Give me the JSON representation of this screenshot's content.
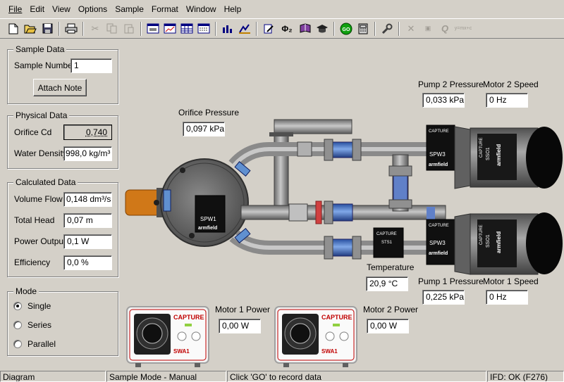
{
  "menu": [
    {
      "u": "F",
      "rest": "ile"
    },
    {
      "u": "E",
      "rest": "dit"
    },
    {
      "u": "V",
      "rest": "iew"
    },
    {
      "u": "O",
      "rest": "ptions"
    },
    {
      "u": "S",
      "rest": "ample"
    },
    {
      "u": "",
      "rest": "Format",
      "u_mid": "o"
    },
    {
      "u": "W",
      "rest": "indow"
    },
    {
      "u": "H",
      "rest": "elp"
    }
  ],
  "menu_labels": [
    "File",
    "Edit",
    "View",
    "Options",
    "Sample",
    "Format",
    "Window",
    "Help"
  ],
  "toolbar": {
    "go_label": "GO",
    "phi_label": "Φ₂",
    "q_label": "Q",
    "formula_label": "y=mx+c"
  },
  "sample_data": {
    "title": "Sample Data",
    "sample_number_label": "Sample Number",
    "sample_number_value": "1",
    "attach_note_label": "Attach Note"
  },
  "physical_data": {
    "title": "Physical Data",
    "orifice_cd_label": "Orifice Cd",
    "orifice_cd_value": "0,740",
    "water_density_label": "Water Density",
    "water_density_value": "998,0 kg/m³"
  },
  "calculated_data": {
    "title": "Calculated Data",
    "volume_flow_label": "Volume Flow",
    "volume_flow_value": "0,148 dm³/s",
    "total_head_label": "Total Head",
    "total_head_value": "0,07 m",
    "power_output_label": "Power Output",
    "power_output_value": "0,1 W",
    "efficiency_label": "Efficiency",
    "efficiency_value": "0,0 %"
  },
  "mode": {
    "title": "Mode",
    "options": [
      "Single",
      "Series",
      "Parallel"
    ],
    "selected": "Single"
  },
  "readings": {
    "orifice_pressure_label": "Orifice Pressure",
    "orifice_pressure_value": "0,097 kPa",
    "pump2_pressure_label": "Pump 2 Pressure",
    "pump2_pressure_value": "0,033 kPa",
    "motor2_speed_label": "Motor 2 Speed",
    "motor2_speed_value": "0 Hz",
    "temperature_label": "Temperature",
    "temperature_value": "20,9 °C",
    "pump1_pressure_label": "Pump 1 Pressure",
    "pump1_pressure_value": "0,225 kPa",
    "motor1_speed_label": "Motor 1 Speed",
    "motor1_speed_value": "0 Hz",
    "motor1_power_label": "Motor 1 Power",
    "motor1_power_value": "0,00 W",
    "motor2_power_label": "Motor 2 Power",
    "motor2_power_value": "0,00 W"
  },
  "equipment": {
    "capture": "CAPTURE",
    "armfield": "armfield",
    "spw1": "SPW1",
    "spw3": "SPW3",
    "sso1": "SSO1",
    "sts1": "STS1",
    "swa1": "SWA1"
  },
  "status": {
    "view": "Diagram",
    "mode": "Sample Mode - Manual",
    "hint": "Click 'GO' to record data",
    "ifd": "IFD: OK (F276)"
  }
}
